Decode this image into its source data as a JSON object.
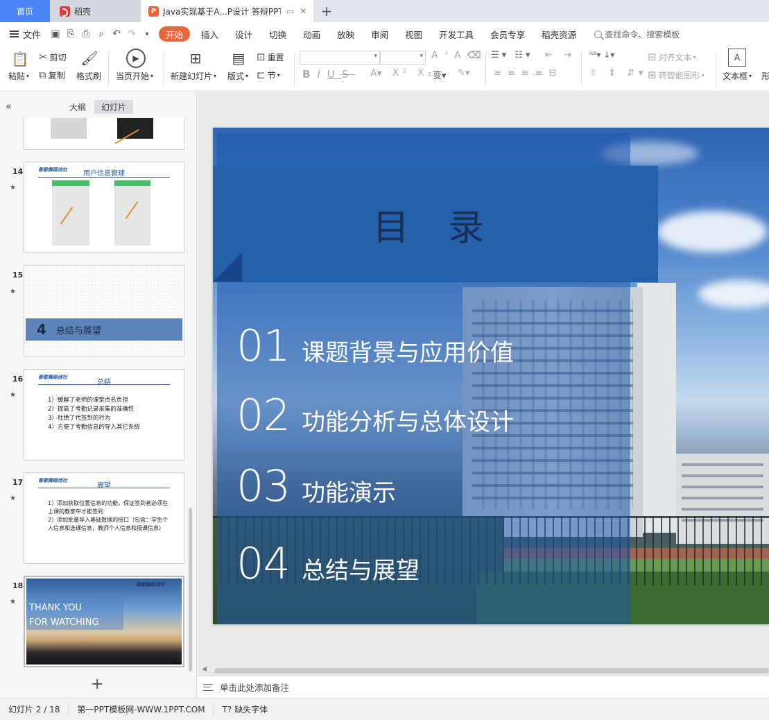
{
  "tabs": {
    "home": "首页",
    "daoke": "稻壳",
    "document": "Java实现基于A...P设计 答辩PPT",
    "logo_letter": "P"
  },
  "menu": {
    "file": "文件",
    "items": [
      "开始",
      "插入",
      "设计",
      "切换",
      "动画",
      "放映",
      "审阅",
      "视图",
      "开发工具",
      "会员专享",
      "稻壳资源"
    ],
    "active": "开始",
    "search": "查找命令、搜索模板"
  },
  "ribbon": {
    "paste": "粘贴",
    "cut": "剪切",
    "copy": "复制",
    "format_painter": "格式刷",
    "from_current": "当页开始",
    "new_slide": "新建幻灯片",
    "layout": "版式",
    "section": "节",
    "reset": "重置",
    "align_text": "对齐文本",
    "smart_art": "转智能图形",
    "text_box": "文本框",
    "shape": "形"
  },
  "panel": {
    "outline_tab": "大纲",
    "slides_tab": "幻灯片",
    "thumbs": [
      {
        "num": "14",
        "title": "用户信息管理"
      },
      {
        "num": "15",
        "section_num": "4",
        "title": "总结与展望"
      },
      {
        "num": "16",
        "title": "总结",
        "items": [
          "1）缓解了老师的课堂点名负担",
          "2）提高了考勤记录采集的准确性",
          "3）杜绝了代签到的行为",
          "4）方便了考勤信息的导入其它系统"
        ]
      },
      {
        "num": "17",
        "title": "展望",
        "items": [
          "1）添加获取位置信息的功能，保证签到者必须在",
          "上课的教室中才能签到",
          "2）添加批量导入基础数据的接口（包含：学生个",
          "人信息和选课信息，教师个人信息和授课信息）"
        ]
      },
      {
        "num": "18",
        "line1": "THANK YOU",
        "line2": "FOR WATCHING"
      }
    ]
  },
  "slide": {
    "title": "目 录",
    "toc": [
      {
        "num": "01",
        "label": "课题背景与应用价值"
      },
      {
        "num": "02",
        "label": "功能分析与总体设计"
      },
      {
        "num": "03",
        "label": "功能演示"
      },
      {
        "num": "04",
        "label": "总结与展望"
      }
    ]
  },
  "notes_placeholder": "单击此处添加备注",
  "status": {
    "slide_counter": "幻灯片 2 / 18",
    "template": "第一PPT模板网-WWW.1PPT.COM",
    "missing_fonts": "缺失字体"
  }
}
